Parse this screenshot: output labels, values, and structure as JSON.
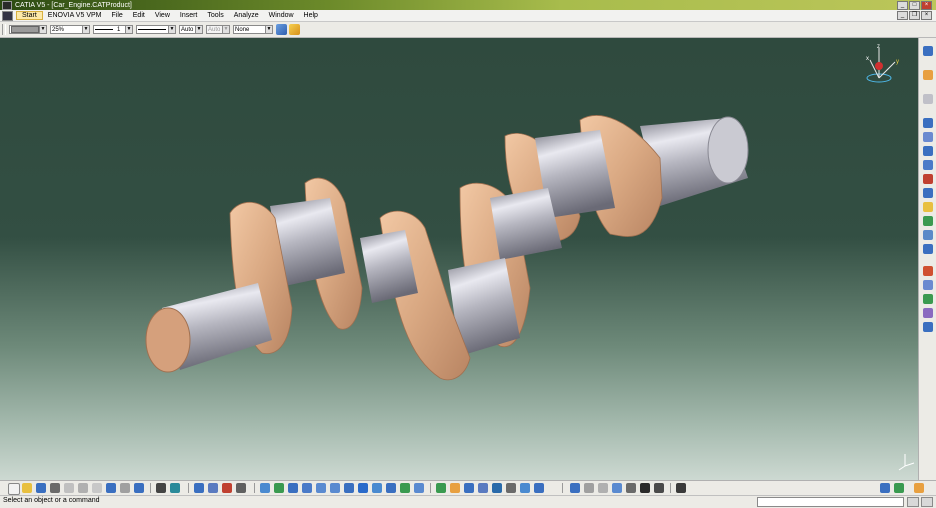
{
  "window": {
    "title": "CATIA V5 - [Car_Engine.CATProduct]",
    "min": "_",
    "max": "□",
    "close": "×"
  },
  "menu": {
    "items": [
      "Start",
      "ENOVIA V5 VPM",
      "File",
      "Edit",
      "View",
      "Insert",
      "Tools",
      "Analyze",
      "Window",
      "Help"
    ],
    "doc_min": "_",
    "doc_restore": "❐",
    "doc_close": "×"
  },
  "properties": {
    "transparency": "25%",
    "line_thickness": "1",
    "point_type": "Auto",
    "layer_disabled": "Auto",
    "layer": "None"
  },
  "status": {
    "message": "Select an object or a command"
  },
  "colors": {
    "accent_orange": "#e8a040",
    "icon_blue": "#3a6fc0",
    "crank_metal": "#c4c4cc",
    "crank_web": "#d9ab88"
  },
  "icons": {
    "compass": "compass-icon",
    "axis_x": "x",
    "axis_y": "y",
    "axis_z": "z"
  }
}
